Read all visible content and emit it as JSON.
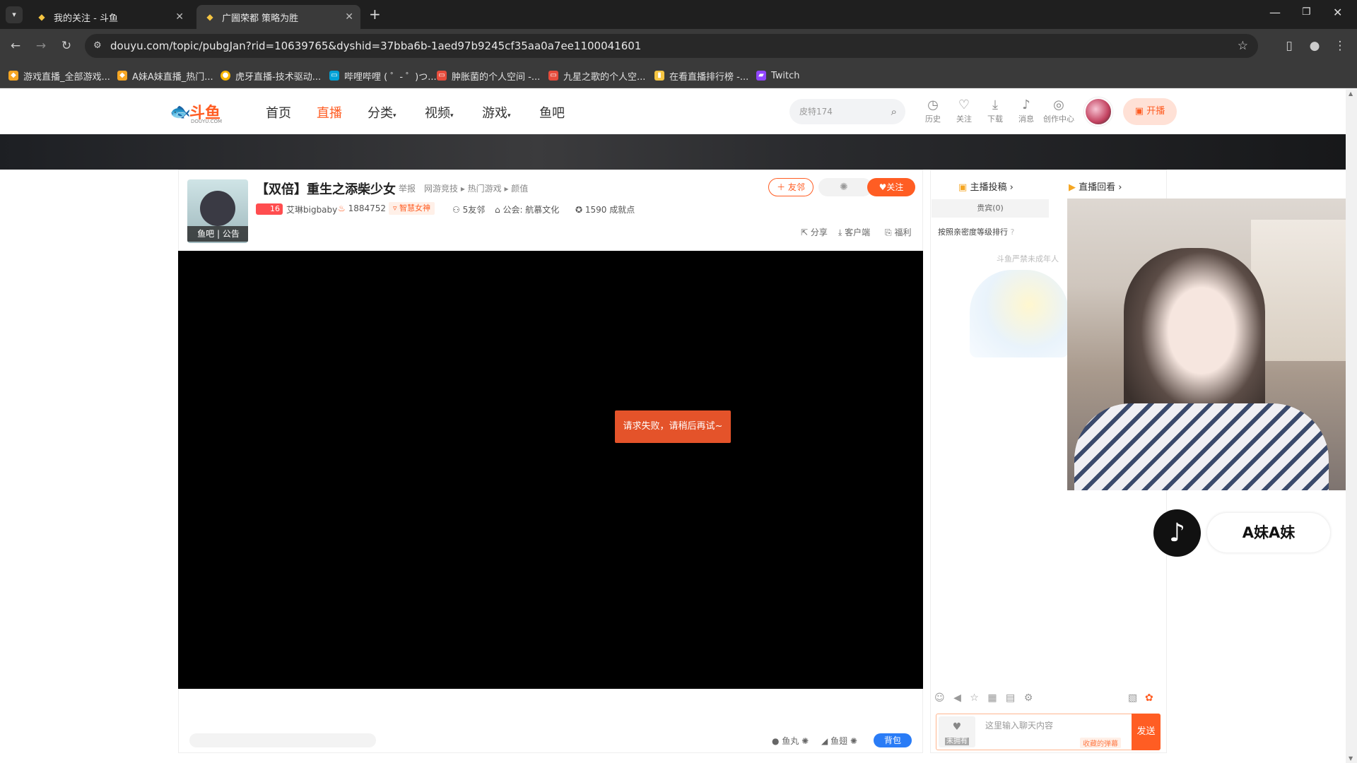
{
  "browser": {
    "tabs": [
      {
        "title": "我的关注 - 斗鱼",
        "active": false
      },
      {
        "title": "广圌荣都 策略为胜",
        "active": true
      }
    ],
    "url": "douyu.com/topic/pubgJan?rid=10639765&dyshid=37bba6b-1aed97b9245cf35aa0a7ee1100041601",
    "bookmarks": [
      {
        "label": "游戏直播_全部游戏...",
        "icon": "douyu-icon"
      },
      {
        "label": "A妹A妹直播_热门...",
        "icon": "douyu-icon"
      },
      {
        "label": "虎牙直播-技术驱动...",
        "icon": "huya-icon"
      },
      {
        "label": "哔哩哔哩 ( ゜- ゜)つ...",
        "icon": "bilibili-icon"
      },
      {
        "label": "肿胀菌的个人空间 -...",
        "icon": "bilibili-red-icon"
      },
      {
        "label": "九星之歌的个人空...",
        "icon": "bilibili-red-icon"
      },
      {
        "label": "在看直播排行榜 -...",
        "icon": "bookmark-icon"
      },
      {
        "label": "Twitch",
        "icon": "twitch-icon"
      }
    ]
  },
  "header": {
    "logo_text": "斗鱼",
    "logo_sub": "DOUYU.COM",
    "nav": [
      {
        "label": "首页",
        "active": false
      },
      {
        "label": "直播",
        "active": true
      },
      {
        "label": "分类",
        "active": false,
        "dropdown": true
      },
      {
        "label": "视频",
        "active": false,
        "dropdown": true
      },
      {
        "label": "游戏",
        "active": false,
        "dropdown": true
      },
      {
        "label": "鱼吧",
        "active": false
      }
    ],
    "search_placeholder": "皮特174",
    "icons": [
      {
        "label": "历史",
        "icon": "clock-icon"
      },
      {
        "label": "关注",
        "icon": "heart-icon"
      },
      {
        "label": "下载",
        "icon": "download-icon"
      },
      {
        "label": "消息",
        "icon": "bell-icon"
      },
      {
        "label": "创作中心",
        "icon": "bulb-icon"
      }
    ],
    "open_btn": "开播"
  },
  "room": {
    "title": "【双倍】重生之添柴少女",
    "report": "举报",
    "categories": "网游竞技 ▸ 热门游戏 ▸ 颜值",
    "level": "16",
    "anchor": "艾琳bigbaby",
    "hot": "1884752",
    "tag": "智慧女神",
    "friends": "5友邻",
    "guild": "公会: 航慕文化",
    "achievement": "1590 成就点",
    "avatar_tabs": [
      "鱼吧",
      "公告"
    ],
    "btn_friend": "友邻",
    "btn_follow": "关注",
    "actions": [
      "分享",
      "客户端",
      "福利"
    ],
    "error": "请求失败，请稍后再试~",
    "bottom": {
      "fish_ball": "鱼丸",
      "fish_wing": "鱼翅",
      "bag": "背包"
    }
  },
  "side": {
    "tabs": [
      "主播投稿",
      "直播回看"
    ],
    "guests_tab": "贵宾(0)",
    "rank_text": "按照亲密度等级排行",
    "notice": "斗鱼严禁未成年人",
    "chat_placeholder": "这里输入聊天内容",
    "collect_label": "收藏的弹幕",
    "send": "发送",
    "badge": "未拥有"
  },
  "overlay": {
    "name": "A妹A妹"
  },
  "colors": {
    "brand": "#ff5d23",
    "error": "#e4532a",
    "chrome_dark": "#1f1f1f",
    "chrome_mid": "#3a3a3a"
  }
}
